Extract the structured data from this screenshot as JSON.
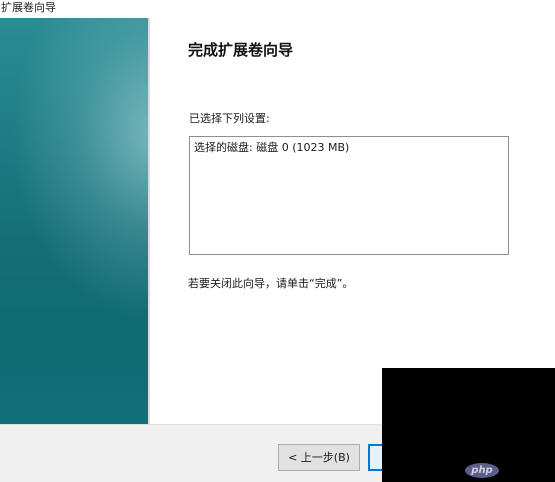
{
  "window": {
    "title": "扩展卷向导"
  },
  "content": {
    "heading": "完成扩展卷向导",
    "settings_label": "已选择下列设置:",
    "settings_lines": [
      "选择的磁盘: 磁盘 0 (1023 MB)"
    ],
    "finish_hint": "若要关闭此向导，请单击“完成”。"
  },
  "buttons": {
    "back_label": "< 上一步(B)"
  },
  "watermark": {
    "text": "php"
  },
  "colors": {
    "banner": "#156e76",
    "accent": "#0078d7"
  }
}
